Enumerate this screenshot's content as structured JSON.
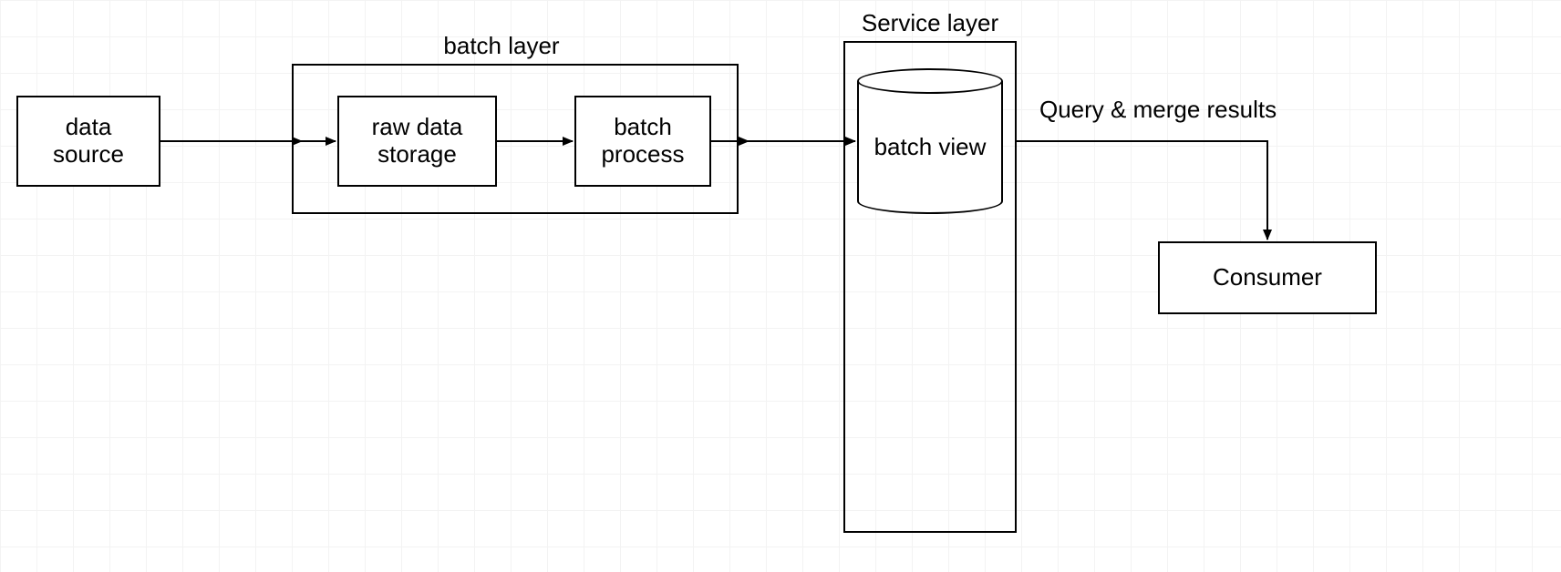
{
  "nodes": {
    "data_source": "data\nsource",
    "raw_data_storage": "raw data\nstorage",
    "batch_process": "batch\nprocess",
    "batch_view": "batch view",
    "consumer": "Consumer"
  },
  "containers": {
    "batch_layer": "batch layer",
    "service_layer": "Service layer"
  },
  "edges": {
    "query_merge": "Query & merge results"
  }
}
